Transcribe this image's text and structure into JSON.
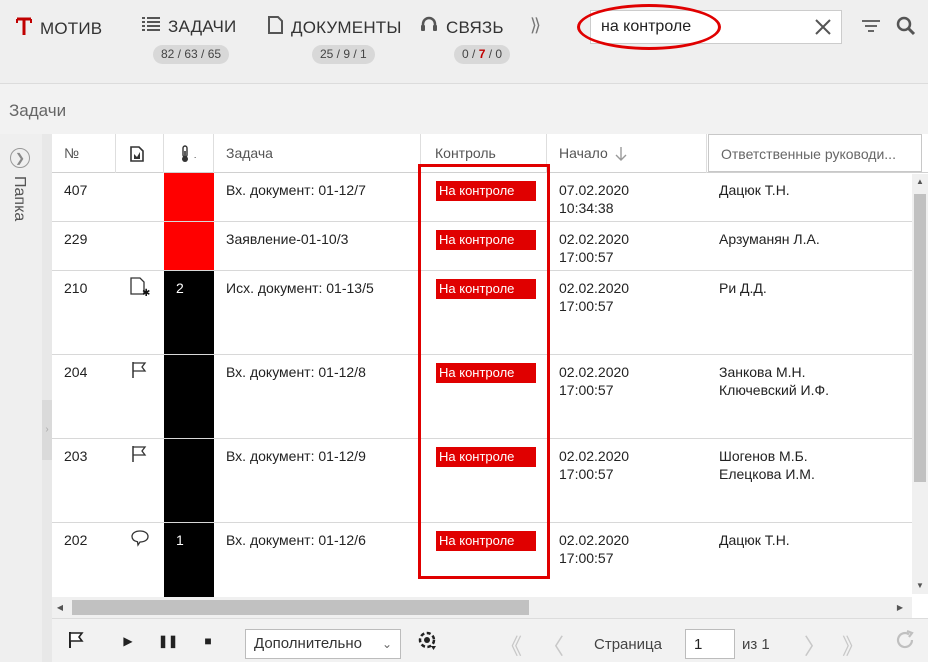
{
  "nav": {
    "logo_icon": "motiv-logo-icon",
    "brand": "МОТИВ",
    "tasks": {
      "label": "ЗАДАЧИ",
      "counts": "82 / 63 / 65"
    },
    "documents": {
      "label": "ДОКУМЕНТЫ",
      "counts": "25 / 9 / 1"
    },
    "comm": {
      "label": "СВЯЗЬ",
      "count_a": "0 / ",
      "count_b": "7",
      "count_c": " / 0"
    },
    "more": "⟩⟩"
  },
  "search": {
    "value": "на контроле"
  },
  "section_title": "Задачи",
  "folder": {
    "label": "Папка"
  },
  "grid": {
    "columns": {
      "num": "№",
      "task": "Задача",
      "control": "Контроль",
      "start": "Начало",
      "responsible": "Ответственные руководи..."
    },
    "rows": [
      {
        "num": "407",
        "icon": "",
        "prio": "",
        "prio_color": "#ff0000",
        "task": "Вх. документ: 01-12/7",
        "control": "На контроле",
        "start_date": "07.02.2020",
        "start_time": "10:34:38",
        "responsible": "Дацюк Т.Н."
      },
      {
        "num": "229",
        "icon": "",
        "prio": "",
        "prio_color": "#ff0000",
        "task": "Заявление-01-10/3",
        "control": "На контроле",
        "start_date": "02.02.2020",
        "start_time": "17:00:57",
        "responsible": "Арзуманян Л.А."
      },
      {
        "num": "210",
        "icon": "document-star-icon",
        "prio": "2",
        "prio_color": "#000000",
        "task": "Исх. документ: 01-13/5",
        "control": "На контроле",
        "start_date": "02.02.2020",
        "start_time": "17:00:57",
        "responsible": "Ри Д.Д."
      },
      {
        "num": "204",
        "icon": "flag-icon",
        "prio": "",
        "prio_color": "#000000",
        "task": "Вх. документ: 01-12/8",
        "control": "На контроле",
        "start_date": "02.02.2020",
        "start_time": "17:00:57",
        "responsible": "Занкова М.Н.\nКлючевский И.Ф."
      },
      {
        "num": "203",
        "icon": "flag-icon",
        "prio": "",
        "prio_color": "#000000",
        "task": "Вх. документ: 01-12/9",
        "control": "На контроле",
        "start_date": "02.02.2020",
        "start_time": "17:00:57",
        "responsible": "Шогенов М.Б.\nЕлецкова И.М."
      },
      {
        "num": "202",
        "icon": "comment-icon",
        "prio": "1",
        "prio_color": "#000000",
        "task": "Вх. документ: 01-12/6",
        "control": "На контроле",
        "start_date": "02.02.2020",
        "start_time": "17:00:57",
        "responsible": "Дацюк Т.Н."
      }
    ]
  },
  "toolbar": {
    "select_value": "Дополнительно",
    "page_label": "Страница",
    "page_value": "1",
    "page_of": "из 1"
  },
  "colors": {
    "accent_red": "#e00000",
    "brand_red": "#c00000"
  }
}
